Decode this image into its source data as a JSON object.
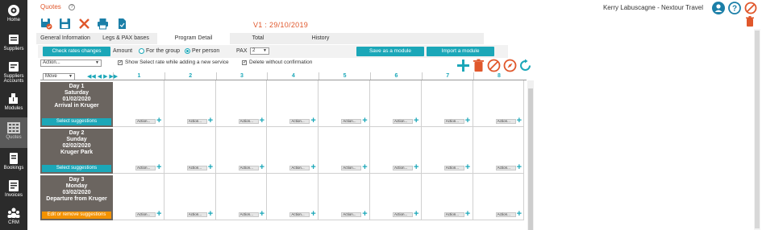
{
  "sidebar": {
    "items": [
      {
        "label": "Home",
        "icon": "home-icon"
      },
      {
        "label": "Suppliers",
        "icon": "suppliers-icon"
      },
      {
        "label": "Suppliers Accounts",
        "icon": "suppliers-accounts-icon"
      },
      {
        "label": "Modules",
        "icon": "modules-icon"
      },
      {
        "label": "Quotes",
        "icon": "quotes-icon",
        "active": true
      },
      {
        "label": "Bookings",
        "icon": "bookings-icon"
      },
      {
        "label": "Invoices",
        "icon": "invoices-icon"
      },
      {
        "label": "CRM",
        "icon": "crm-icon"
      }
    ]
  },
  "header": {
    "title": "Quotes",
    "help": "?",
    "user": "Kerry Labuscagne - Nextour Travel",
    "version": "V1 : 29/10/2019"
  },
  "tabs": [
    {
      "label": "General Information"
    },
    {
      "label": "Legs & PAX bases"
    },
    {
      "label": "Program Detail",
      "active": true
    },
    {
      "label": "Total"
    },
    {
      "label": "History"
    }
  ],
  "options": {
    "check_rates": "Check rates changes",
    "amount_label": "Amount",
    "for_group": "For the group",
    "per_person": "Per person",
    "pax_label": "PAX",
    "pax_value": "2",
    "save_module": "Save as a module",
    "import_module": "Import a module",
    "action_select": "Action...",
    "show_select_rate": "Show Select rate while adding a new service",
    "delete_without_confirmation": "Delete without confirmation",
    "move_select": "Move"
  },
  "grid": {
    "columns": [
      "1",
      "2",
      "3",
      "4",
      "5",
      "6",
      "7",
      "8"
    ],
    "slot_action": "Action...",
    "days": [
      {
        "day": "Day 1",
        "weekday": "Saturday",
        "date": "01/02/2020",
        "desc": "Arrival in Kruger",
        "button": "Select suggestions",
        "button_color": "#1ba7b8"
      },
      {
        "day": "Day 2",
        "weekday": "Sunday",
        "date": "02/02/2020",
        "desc": "Kruger Park",
        "button": "Select suggestions",
        "button_color": "#1ba7b8"
      },
      {
        "day": "Day 3",
        "weekday": "Monday",
        "date": "03/02/2020",
        "desc": "Departure from Kruger",
        "button": "Edit or remove suggestions",
        "button_color": "#f39200"
      }
    ]
  },
  "colors": {
    "accent": "#1ba7b8",
    "title": "#e0572b",
    "danger": "#e0572b",
    "sidebar": "#2b2b2b"
  }
}
